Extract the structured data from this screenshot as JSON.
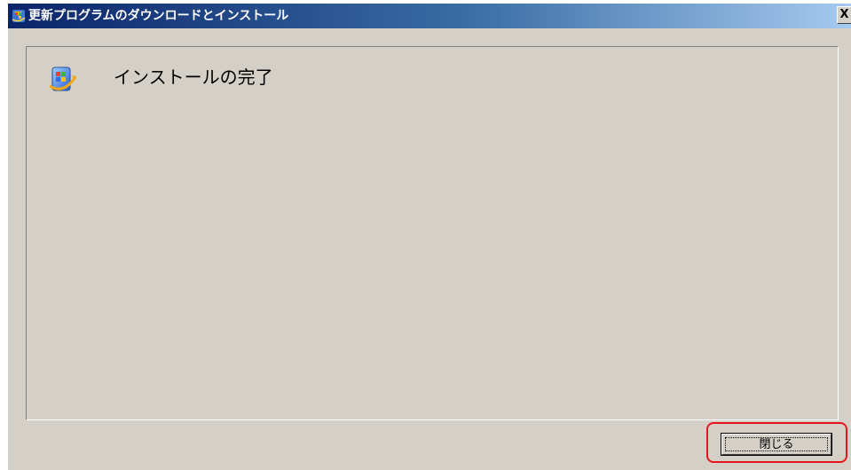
{
  "window": {
    "title": "更新プログラムのダウンロードとインストール",
    "close_label": "X",
    "title_icon": "windows-update-icon",
    "background_color": "#d4d0c8",
    "title_bar_color": "#0a246a"
  },
  "content": {
    "icon": "windows-update-icon",
    "heading": "インストールの完了"
  },
  "footer": {
    "close_button_label": "閉じる"
  },
  "annotation": {
    "highlight_color": "#e8141b",
    "highlight_target": "close-button"
  }
}
